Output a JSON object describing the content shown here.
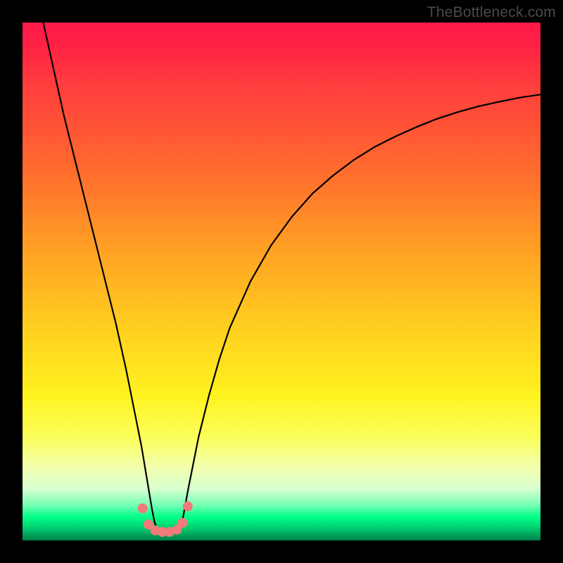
{
  "watermark": "TheBottleneck.com",
  "chart_data": {
    "type": "line",
    "title": "",
    "xlabel": "",
    "ylabel": "",
    "xlim": [
      0,
      100
    ],
    "ylim": [
      0,
      100
    ],
    "grid": false,
    "series": [
      {
        "name": "curve",
        "color": "#000000",
        "x": [
          4,
          6,
          8,
          10,
          12,
          14,
          16,
          18,
          20,
          21,
          22,
          23,
          24,
          25,
          25.5,
          26,
          27,
          28,
          29,
          30,
          30.5,
          31,
          32,
          34,
          36,
          38,
          40,
          44,
          48,
          52,
          56,
          60,
          64,
          68,
          72,
          76,
          80,
          84,
          88,
          92,
          96,
          100
        ],
        "y": [
          100,
          91,
          82,
          74,
          66,
          58,
          50,
          42,
          33,
          28,
          23,
          18,
          12,
          6,
          3.5,
          2.2,
          1.6,
          1.4,
          1.4,
          1.8,
          2.6,
          4.5,
          10,
          20,
          28,
          35,
          41,
          50,
          57,
          62.5,
          67,
          70.5,
          73.5,
          76,
          78,
          79.8,
          81.4,
          82.7,
          83.8,
          84.7,
          85.5,
          86.1
        ]
      }
    ],
    "markers": {
      "color": "#f27a7a",
      "radius_px": 7,
      "points": [
        {
          "x": 23.2,
          "y": 6.2
        },
        {
          "x": 24.3,
          "y": 3.1
        },
        {
          "x": 25.6,
          "y": 1.95
        },
        {
          "x": 27.0,
          "y": 1.65
        },
        {
          "x": 28.4,
          "y": 1.65
        },
        {
          "x": 29.8,
          "y": 2.1
        },
        {
          "x": 30.9,
          "y": 3.4
        },
        {
          "x": 31.9,
          "y": 6.6
        }
      ]
    },
    "background_gradient": {
      "orientation": "vertical",
      "stops": [
        {
          "pos": 0.0,
          "color": "#ff1a4a"
        },
        {
          "pos": 0.28,
          "color": "#ff6a2e"
        },
        {
          "pos": 0.6,
          "color": "#ffd21f"
        },
        {
          "pos": 0.8,
          "color": "#fcff5a"
        },
        {
          "pos": 0.955,
          "color": "#00ff87"
        },
        {
          "pos": 1.0,
          "color": "#008048"
        }
      ]
    }
  }
}
